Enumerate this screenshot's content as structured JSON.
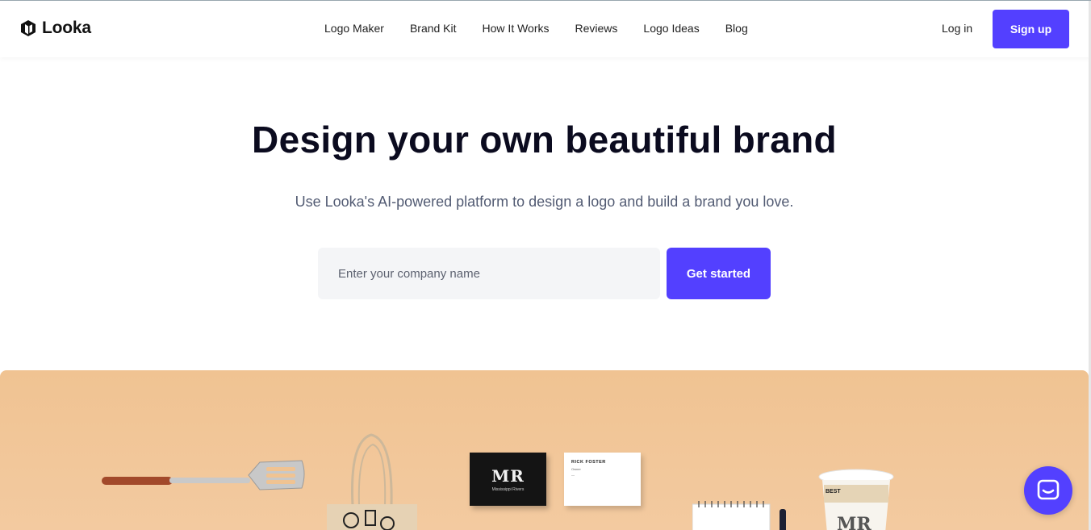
{
  "brand": {
    "name": "Looka"
  },
  "nav": {
    "items": [
      {
        "label": "Logo Maker"
      },
      {
        "label": "Brand Kit"
      },
      {
        "label": "How It Works"
      },
      {
        "label": "Reviews"
      },
      {
        "label": "Logo Ideas"
      },
      {
        "label": "Blog"
      }
    ],
    "login_label": "Log in",
    "signup_label": "Sign up"
  },
  "hero": {
    "title": "Design your own beautiful brand",
    "subtitle": "Use Looka's AI-powered platform to design a logo and build a brand you love.",
    "input_placeholder": "Enter your company name",
    "input_value": "",
    "cta_label": "Get started"
  },
  "showcase": {
    "card_dark_monogram": "MR",
    "card_dark_caption": "Mississippi Rivers",
    "card_white_name": "RICK FOSTER",
    "card_white_role": "Owner",
    "cup_label": "BEST",
    "cup_monogram": "MR"
  },
  "icons": {
    "logo": "looka-logo-icon",
    "chat": "chat-icon"
  },
  "colors": {
    "accent": "#5340ff",
    "showcase_bg": "#f0c392",
    "title": "#0b0b1f",
    "subtitle": "#525b73"
  }
}
